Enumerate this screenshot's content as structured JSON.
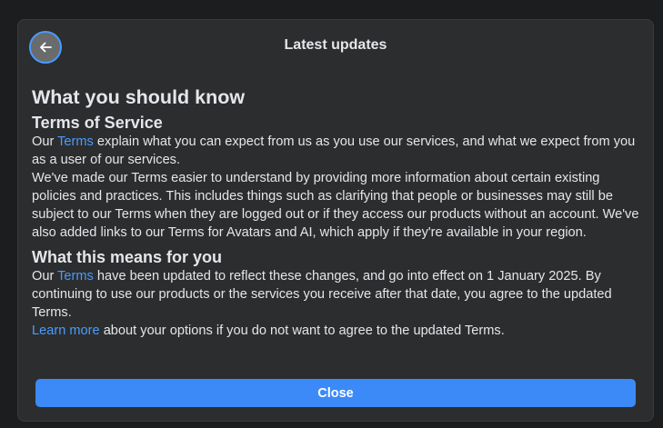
{
  "header": {
    "title": "Latest updates",
    "back_icon": "arrow-left-icon"
  },
  "main": {
    "heading": "What you should know",
    "section1": {
      "title": "Terms of Service",
      "p1_before": "Our ",
      "p1_link": "Terms",
      "p1_after": " explain what you can expect from us as you use our services, and what we expect from you as a user of our services.",
      "p2": "We've made our Terms easier to understand by providing more information about certain existing policies and practices. This includes things such as clarifying that people or businesses may still be subject to our Terms when they are logged out or if they access our products without an account. We've also added links to our Terms for Avatars and AI, which apply if they're available in your region."
    },
    "section2": {
      "title": "What this means for you",
      "p1_before": "Our ",
      "p1_link": "Terms",
      "p1_after": " have been updated to reflect these changes, and go into effect on 1 January 2025. By continuing to use our products or the services you receive after that date, you agree to the updated Terms.",
      "p2_link": "Learn more",
      "p2_after": " about your options if you do not want to agree to the updated Terms."
    }
  },
  "footer": {
    "close_label": "Close"
  },
  "colors": {
    "background": "#1c1d1e",
    "dialog": "#2c2d2e",
    "link": "#4a9bff",
    "button": "#3b8af7"
  }
}
